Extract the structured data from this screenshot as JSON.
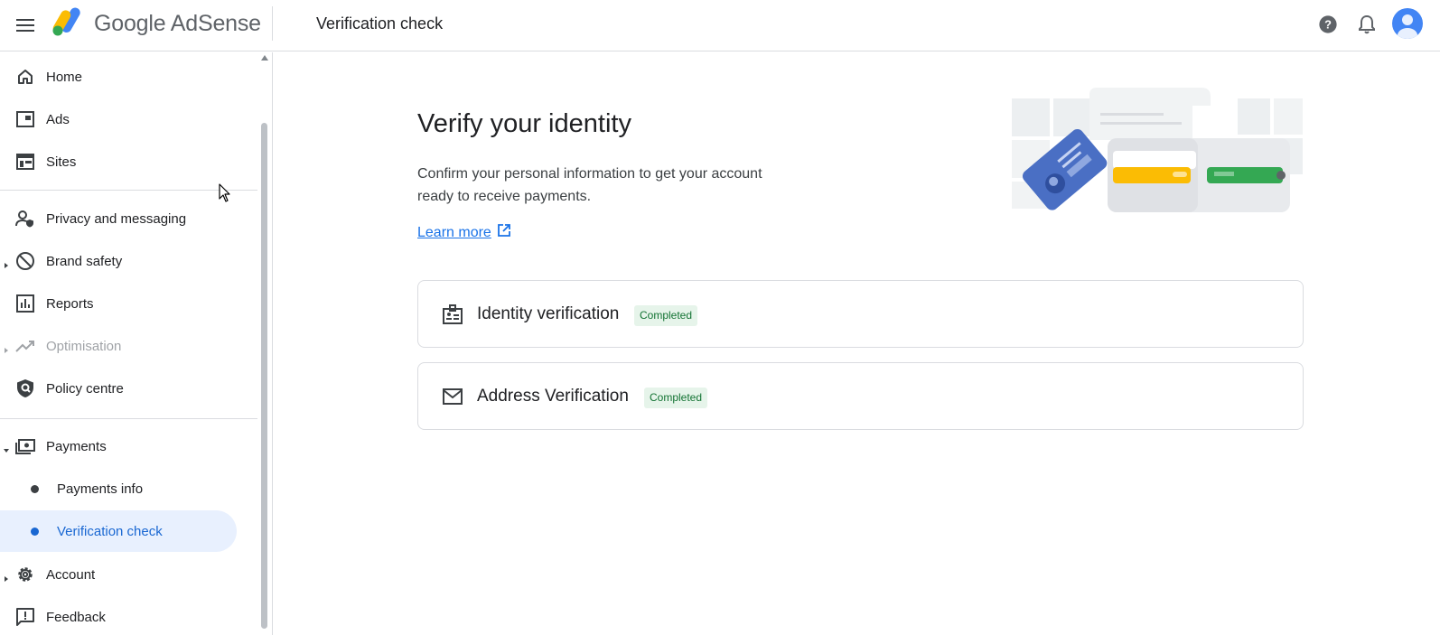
{
  "header": {
    "brand_google": "Google",
    "brand_product": "AdSense",
    "page_title": "Verification check"
  },
  "sidebar": {
    "items": [
      {
        "label": "Home",
        "icon": "home-icon"
      },
      {
        "label": "Ads",
        "icon": "ads-icon"
      },
      {
        "label": "Sites",
        "icon": "sites-icon"
      },
      {
        "label": "Privacy and messaging",
        "icon": "privacy-icon"
      },
      {
        "label": "Brand safety",
        "icon": "block-icon"
      },
      {
        "label": "Reports",
        "icon": "reports-icon"
      },
      {
        "label": "Optimisation",
        "icon": "trending-icon"
      },
      {
        "label": "Policy centre",
        "icon": "policy-shield-icon"
      },
      {
        "label": "Payments",
        "icon": "payments-icon"
      },
      {
        "label": "Payments info"
      },
      {
        "label": "Verification check"
      },
      {
        "label": "Account",
        "icon": "gear-icon"
      },
      {
        "label": "Feedback",
        "icon": "feedback-icon"
      }
    ]
  },
  "main": {
    "title": "Verify your identity",
    "description": "Confirm your personal information to get your account ready to receive payments.",
    "learn_more": "Learn more",
    "cards": [
      {
        "title": "Identity verification",
        "status": "Completed",
        "icon": "id-badge-icon"
      },
      {
        "title": "Address Verification",
        "status": "Completed",
        "icon": "mail-icon"
      }
    ]
  },
  "colors": {
    "accent": "#1a73e8",
    "active_bg": "#e8f0fe",
    "badge_bg": "#e6f4ea",
    "badge_text": "#137333"
  }
}
